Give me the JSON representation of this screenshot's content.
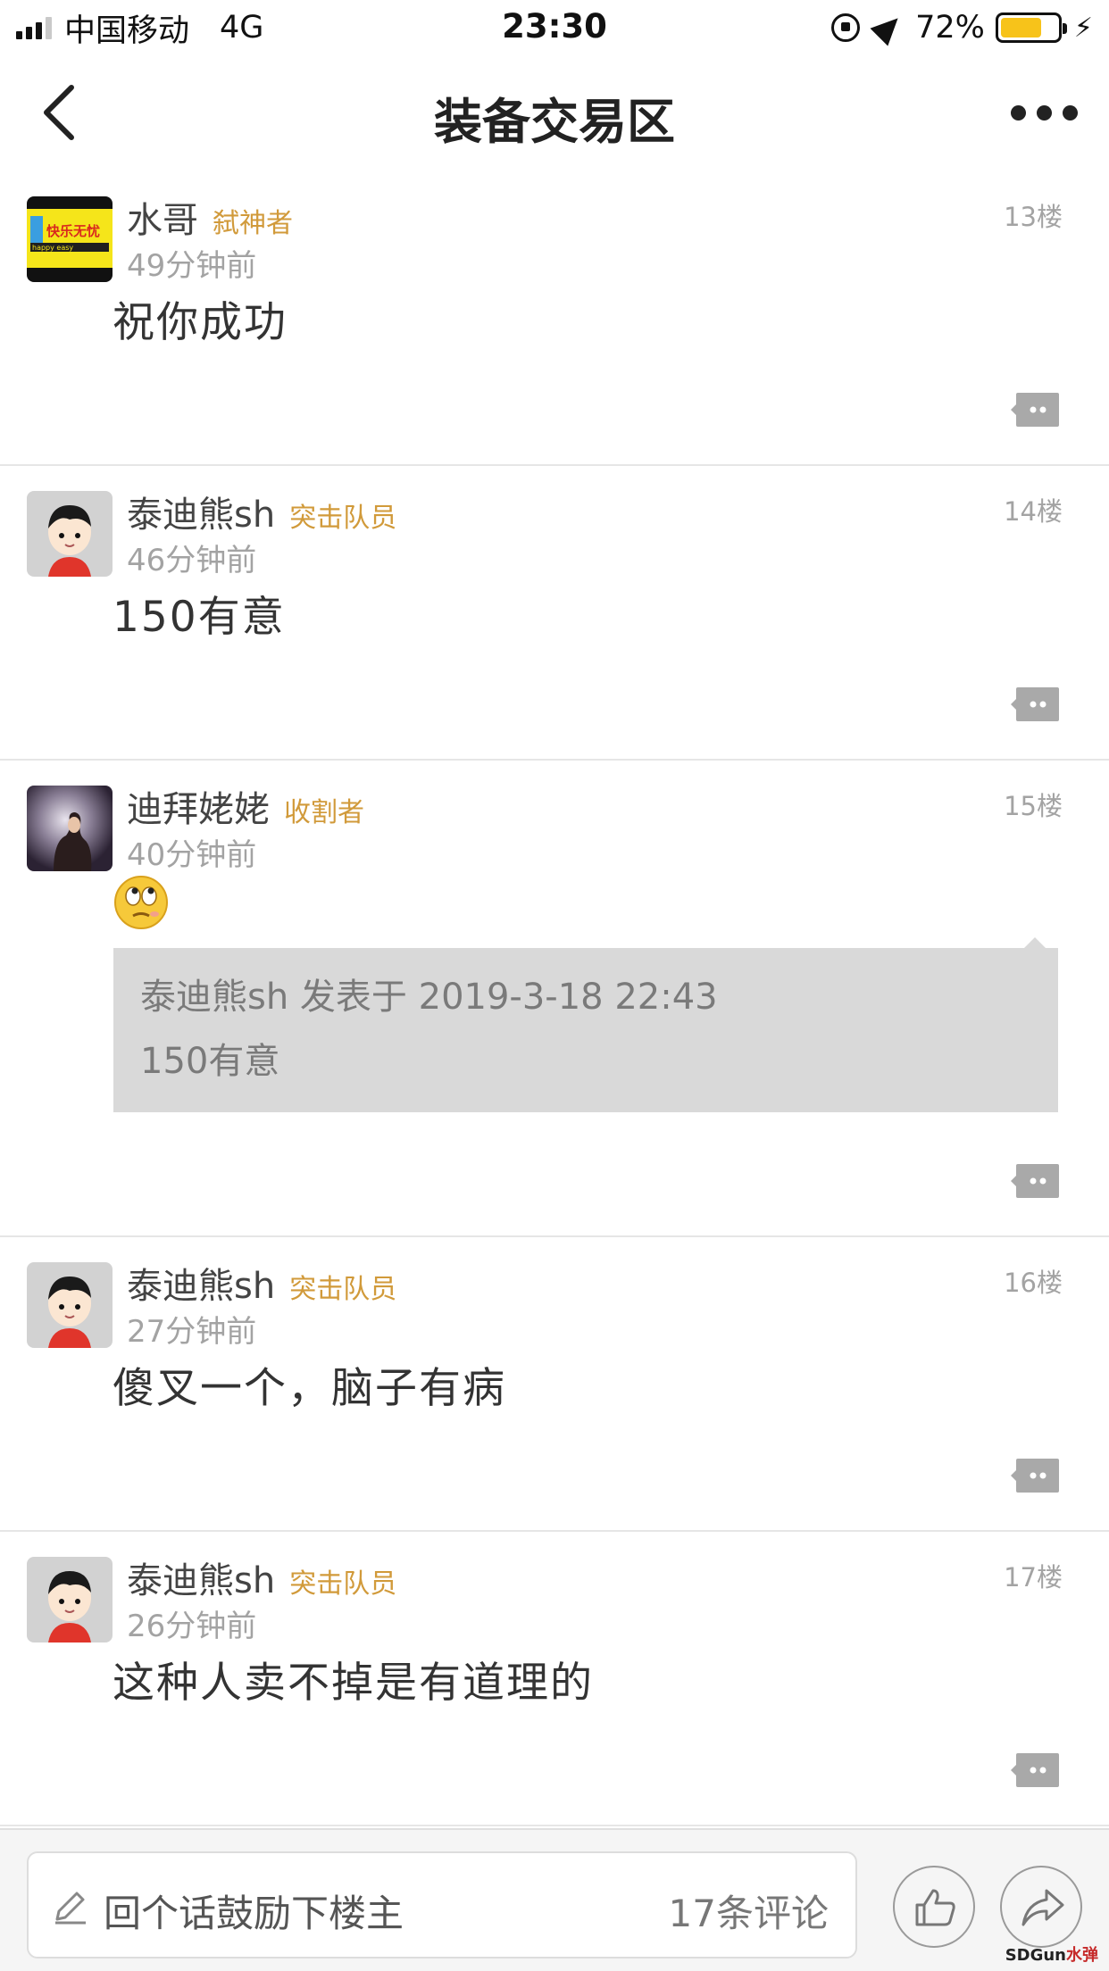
{
  "status_bar": {
    "carrier": "中国移动",
    "network": "4G",
    "time": "23:30",
    "battery": "72%",
    "battery_level": 0.72
  },
  "nav": {
    "title": "装备交易区"
  },
  "comments": [
    {
      "name": "水哥",
      "badge": "弑神者",
      "time": "49分钟前",
      "floor": "13楼",
      "text": "祝你成功",
      "avatar_text": "快乐无忧",
      "avatar_subtext": "happy easy"
    },
    {
      "name": "泰迪熊sh",
      "badge": "突击队员",
      "time": "46分钟前",
      "floor": "14楼",
      "text": "150有意"
    },
    {
      "name": "迪拜姥姥",
      "badge": "收割者",
      "time": "40分钟前",
      "floor": "15楼",
      "quote": {
        "header": "泰迪熊sh 发表于 2019-3-18 22:43",
        "body": "150有意"
      }
    },
    {
      "name": "泰迪熊sh",
      "badge": "突击队员",
      "time": "27分钟前",
      "floor": "16楼",
      "text": "傻叉一个，脑子有病"
    },
    {
      "name": "泰迪熊sh",
      "badge": "突击队员",
      "time": "26分钟前",
      "floor": "17楼",
      "text": "这种人卖不掉是有道理的"
    }
  ],
  "bottom_bar": {
    "placeholder": "回个话鼓励下楼主",
    "comment_count": "17条评论"
  },
  "watermark": {
    "text": "SDGun",
    "red_text": "水弹"
  },
  "colors": {
    "badge": "#d19a3a",
    "battery": "#f7c31a",
    "quote_bg": "#d9d9d9"
  }
}
